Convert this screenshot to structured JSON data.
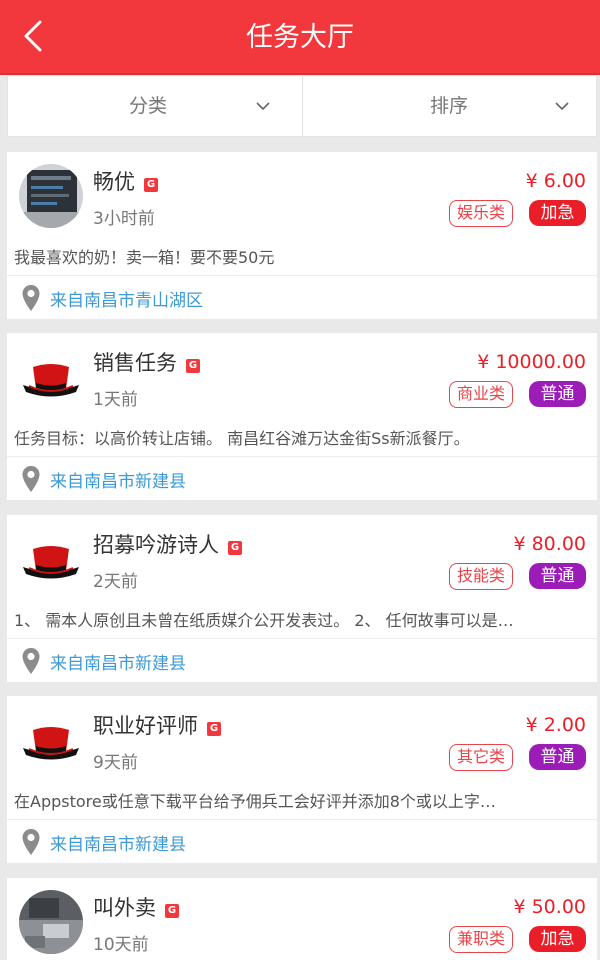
{
  "header": {
    "title": "任务大厅"
  },
  "filters": {
    "category": "分类",
    "sort": "排序"
  },
  "colors": {
    "brand": "#f2383c",
    "urgent": "#ea1e28",
    "normal": "#9b1cb7",
    "location": "#3c9ad5"
  },
  "tasks": [
    {
      "name": "畅优",
      "badge": "G",
      "time": "3小时前",
      "price": "¥ 6.00",
      "category": "娱乐类",
      "priority": "加急",
      "priority_type": "urgent",
      "description": "我最喜欢的奶！卖一箱！要不要50元",
      "location": "来自南昌市青山湖区"
    },
    {
      "name": "销售任务",
      "badge": "G",
      "time": "1天前",
      "price": "¥ 10000.00",
      "category": "商业类",
      "priority": "普通",
      "priority_type": "normal",
      "description": "任务目标：以高价转让店铺。 南昌红谷滩万达金街Ss新派餐厅。",
      "location": "来自南昌市新建县"
    },
    {
      "name": "招募吟游诗人",
      "badge": "G",
      "time": "2天前",
      "price": "¥ 80.00",
      "category": "技能类",
      "priority": "普通",
      "priority_type": "normal",
      "description": "1、 需本人原创且未曾在纸质媒介公开发表过。 2、 任何故事可以是…",
      "location": "来自南昌市新建县"
    },
    {
      "name": "职业好评师",
      "badge": "G",
      "time": "9天前",
      "price": "¥ 2.00",
      "category": "其它类",
      "priority": "普通",
      "priority_type": "normal",
      "description": "在Appstore或任意下载平台给予佣兵工会好评并添加8个或以上字…",
      "location": "来自南昌市新建县"
    },
    {
      "name": "叫外卖",
      "badge": "G",
      "time": "10天前",
      "price": "¥ 50.00",
      "category": "兼职类",
      "priority": "加急",
      "priority_type": "urgent"
    }
  ]
}
